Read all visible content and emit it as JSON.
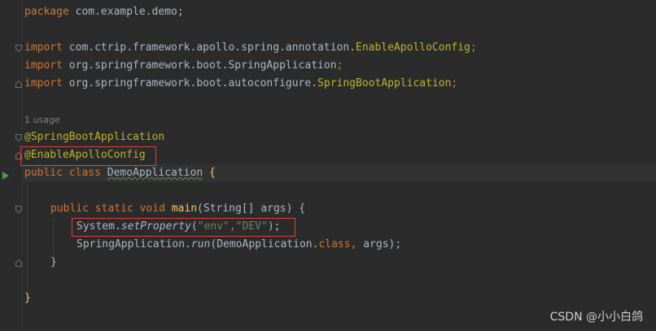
{
  "code": {
    "package_kw": "package",
    "package_name": " com.example.demo;",
    "import_kw": "import",
    "import1_path": " com.ctrip.framework.apollo.spring.annotation.",
    "import1_class": "EnableApolloConfig",
    "import1_end": ";",
    "import2_path": " org.springframework.boot.SpringApplication",
    "import2_end": ";",
    "import3_path": " org.springframework.boot.autoconfigure.",
    "import3_class": "SpringBootApplication",
    "import3_end": ";",
    "usage_hint": "1 usage",
    "annotation1": "@SpringBootApplication",
    "annotation2": "@EnableApolloConfig",
    "public_kw": "public",
    "class_kw": " class ",
    "class_name": "DemoApplication",
    "open_brace": " {",
    "static_kw": " static ",
    "void_kw": "void ",
    "main_name": "main",
    "main_params": "(String[] args) {",
    "system_obj": "System.",
    "set_property": "setProperty",
    "paren_open": "(",
    "arg_env": "\"env\"",
    "comma": ",",
    "arg_dev": "\"DEV\"",
    "paren_close": ");",
    "spring_obj": "SpringApplication.",
    "run_name": "run",
    "run_args_start": "(DemoApplication.",
    "class_ref": "class",
    "run_comma": ",",
    "run_args_end": " args);",
    "close_inner": "}",
    "close_outer": "}"
  },
  "watermark": "CSDN @小小白鸽",
  "icons": {
    "run": "run-gutter-icon",
    "fold": "fold-marker-icon"
  },
  "colors": {
    "background": "#2b2b2b",
    "keyword": "#cc7832",
    "annotation": "#bbb529",
    "string": "#6a8759",
    "method": "#ffc66d",
    "text": "#a9b7c6",
    "highlight_box": "#e53e3e"
  }
}
